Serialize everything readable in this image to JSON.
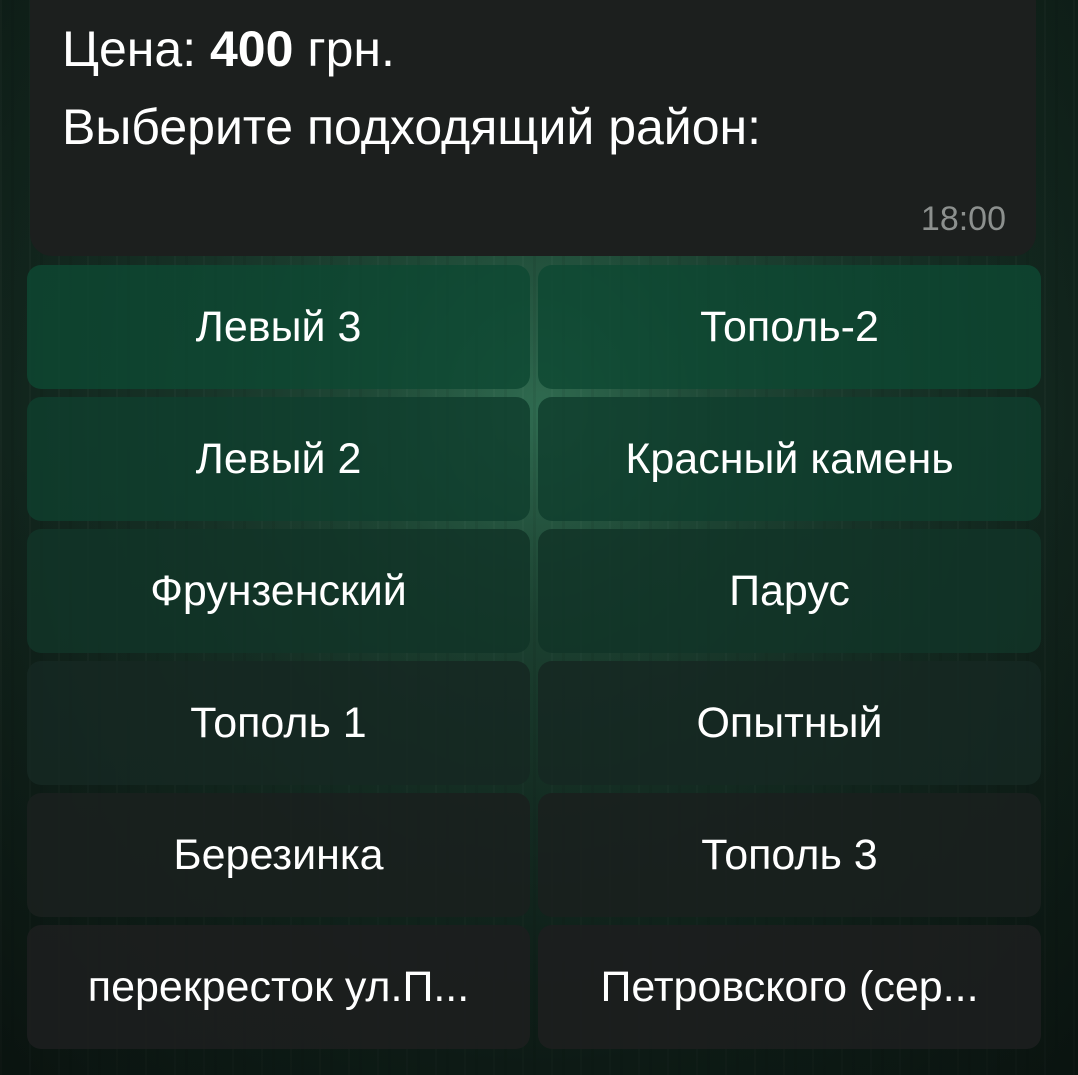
{
  "message": {
    "price_label": "Цена: ",
    "price_value": "400",
    "price_unit": " грн.",
    "prompt": "Выберите подходящий район:",
    "time": "18:00"
  },
  "keyboard": {
    "rows": [
      [
        "Левый 3",
        "Тополь-2"
      ],
      [
        "Левый 2",
        "Красный камень"
      ],
      [
        "Фрунзенский",
        "Парус"
      ],
      [
        "Тополь 1",
        "Опытный"
      ],
      [
        "Березинка",
        "Тополь 3"
      ],
      [
        "перекресток ул.П...",
        "Петровского (сер..."
      ]
    ]
  },
  "colors": {
    "bubble": "#1c1f1e",
    "timestamp": "#8c908e",
    "button_green": "#0e4832",
    "button_dark": "#1c1e1e"
  }
}
